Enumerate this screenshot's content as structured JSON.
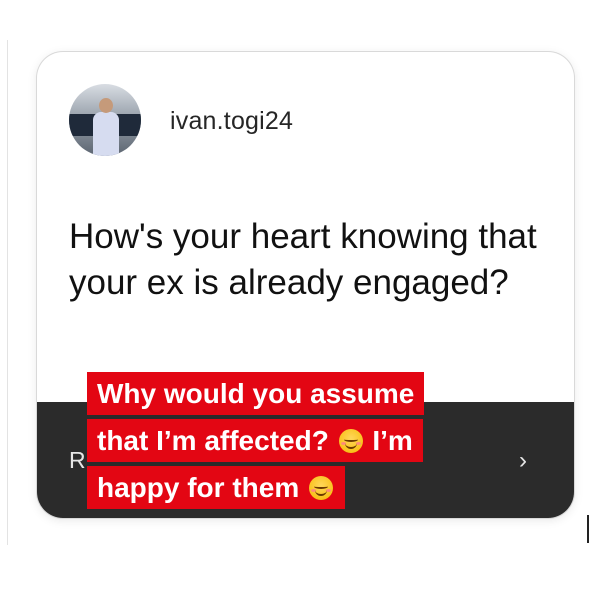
{
  "post": {
    "username": "ivan.togi24",
    "avatar_icon": "profile-photo-avatar",
    "question": "How's your heart knowing that your ex is already engaged?"
  },
  "reply_bar": {
    "partial_text": "R",
    "arrow_icon": "chevron-right-icon",
    "arrow_glyph": "›"
  },
  "answer": {
    "line1": "Why would you assume",
    "line2_text": "that I’m affected?",
    "line2_emoji": "smiling-face-emoji",
    "line2_tail": "I’m",
    "line3_text": "happy for them",
    "line3_emoji": "smiling-face-emoji",
    "highlight_color": "#e30613",
    "text_color": "#ffffff"
  }
}
